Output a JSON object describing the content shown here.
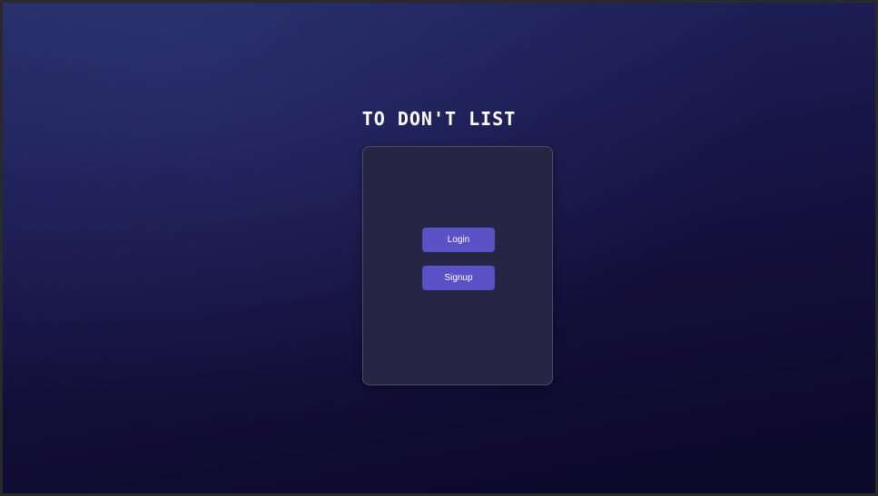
{
  "app": {
    "title": "TO DON'T LIST"
  },
  "auth_card": {
    "login_label": "Login",
    "signup_label": "Signup"
  },
  "colors": {
    "background_top": "#232960",
    "background_bottom": "#0d0a2a",
    "card": "#262544",
    "button": "#5a51c6",
    "text": "#ffffff"
  }
}
